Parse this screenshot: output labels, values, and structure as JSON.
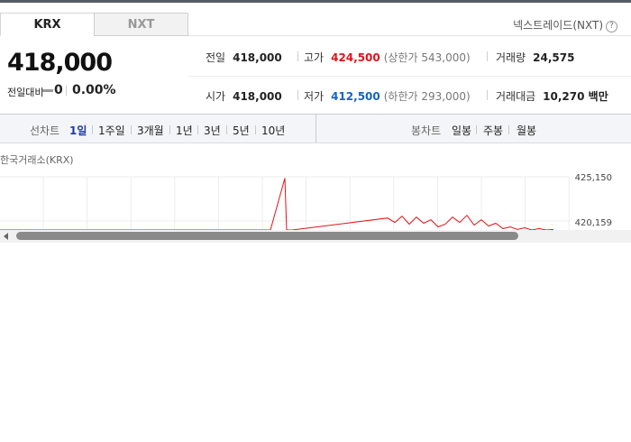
{
  "tabs": [
    "KRX",
    "NXT"
  ],
  "nextrade_label": "넥스트레이드(NXT)",
  "help_icon_glyph": "?",
  "price": "418,000",
  "change": {
    "label": "전일대비",
    "value": "0",
    "percent": "0.00%"
  },
  "stats": {
    "prev_close": {
      "label": "전일",
      "value": "418,000"
    },
    "high": {
      "label": "고가",
      "value": "424,500",
      "limit": "(상한가 543,000)"
    },
    "volume": {
      "label": "거래량",
      "value": "24,575"
    },
    "open": {
      "label": "시가",
      "value": "418,000"
    },
    "low": {
      "label": "저가",
      "value": "412,500",
      "limit": "(하한가 293,000)"
    },
    "turnover": {
      "label": "거래대금",
      "value": "10,270 백만"
    }
  },
  "controls": {
    "line_chart_label": "선차트",
    "periods": [
      "1일",
      "1주일",
      "3개월",
      "1년",
      "3년",
      "5년",
      "10년"
    ],
    "active_period": "1일",
    "candle_chart_label": "봉차트",
    "candles": [
      "일봉",
      "주봉",
      "월봉"
    ]
  },
  "exchange_label": "한국거래소(KRX)",
  "chart_data": {
    "type": "line",
    "y_ticks": [
      "425,150",
      "420,159"
    ],
    "series": [
      {
        "values": [
          417500,
          417500,
          417500,
          425000,
          417500,
          417600,
          417400,
          417500,
          420500,
          420000,
          420700,
          419800,
          420600,
          419900,
          420300,
          419500,
          419800,
          420600,
          420000,
          420800,
          419700,
          420300,
          419600,
          419900,
          419300,
          419500,
          419200,
          419400,
          419100,
          419300,
          419000,
          419200
        ],
        "color": "#e0141a"
      }
    ],
    "grid": true
  }
}
